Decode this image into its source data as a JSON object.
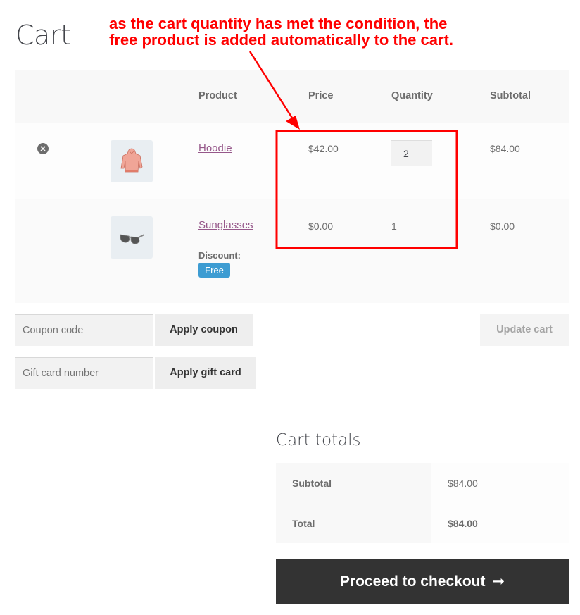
{
  "page": {
    "title": "Cart"
  },
  "annotation": {
    "text_line1": "as the cart quantity has met the condition, the",
    "text_line2": "free product is added automatically to the cart.",
    "color": "#ff0000"
  },
  "cart_table": {
    "headers": {
      "product": "Product",
      "price": "Price",
      "quantity": "Quantity",
      "subtotal": "Subtotal"
    },
    "rows": [
      {
        "name": "Hoodie",
        "thumbnail_icon": "hoodie-icon",
        "price": "$42.00",
        "quantity": "2",
        "quantity_editable": true,
        "subtotal": "$84.00",
        "removable": true,
        "remove_icon": "×"
      },
      {
        "name": "Sunglasses",
        "thumbnail_icon": "sunglasses-icon",
        "price": "$0.00",
        "quantity": "1",
        "quantity_editable": false,
        "subtotal": "$0.00",
        "removable": false,
        "discount_label": "Discount:",
        "discount_badge": "Free"
      }
    ]
  },
  "coupon": {
    "placeholder": "Coupon code",
    "apply_label": "Apply coupon"
  },
  "gift_card": {
    "placeholder": "Gift card number",
    "apply_label": "Apply gift card"
  },
  "update_cart_label": "Update cart",
  "totals": {
    "title": "Cart totals",
    "rows": [
      {
        "label": "Subtotal",
        "value": "$84.00"
      },
      {
        "label": "Total",
        "value": "$84.00"
      }
    ]
  },
  "checkout": {
    "label": "Proceed to checkout",
    "arrow": "➞"
  },
  "colors": {
    "link": "#96588a",
    "badge": "#3d9cd2",
    "checkout_bg": "#333333",
    "annotation": "#ff0000"
  }
}
